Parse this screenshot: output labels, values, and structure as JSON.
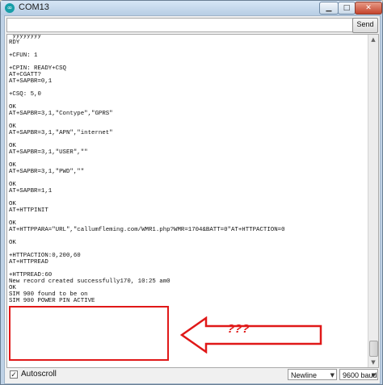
{
  "window": {
    "title": "COM13",
    "app_icon": "arduino-icon",
    "minimize_icon": "minimize-icon",
    "maximize_icon": "maximize-icon",
    "close_icon": "close-icon"
  },
  "input": {
    "value": "",
    "placeholder": ""
  },
  "send_label": "Send",
  "output_lines": [
    " ÿÿÿÿÿÿÿÿ",
    "RDY",
    "",
    "+CFUN: 1",
    "",
    "+CPIN: READY+CSQ",
    "AT+CGATT?",
    "AT+SAPBR=0,1",
    "",
    "+CSQ: 5,0",
    "",
    "OK",
    "AT+SAPBR=3,1,\"Contype\",\"GPRS\"",
    "",
    "OK",
    "AT+SAPBR=3,1,\"APN\",\"internet\"",
    "",
    "OK",
    "AT+SAPBR=3,1,\"USER\",\"\"",
    "",
    "OK",
    "AT+SAPBR=3,1,\"PWD\",\"\"",
    "",
    "OK",
    "AT+SAPBR=1,1",
    "",
    "OK",
    "AT+HTTPINIT",
    "",
    "OK",
    "AT+HTTPPARA=\"URL\",\"callumfleming.com/WMR1.php?WMR=1704&BATT=0\"AT+HTTPACTION=0",
    "",
    "OK",
    "",
    "+HTTPACTION:0,200,60",
    "AT+HTTPREAD",
    "",
    "+HTTPREAD:60",
    "New record created successfully170, 10:25 am0",
    "OK",
    "SIM 900 found to be on",
    "SIM 900 POWER PIN ACTIVE",
    "",
    ""
  ],
  "annotation": {
    "label": "???",
    "color": "#e01818"
  },
  "footer": {
    "autoscroll_checked": true,
    "autoscroll_label": "Autoscroll",
    "line_ending": "Newline",
    "baud": "9600 baud"
  },
  "colors": {
    "title_bar": "#c9dbee",
    "annotation_red": "#e01818"
  }
}
